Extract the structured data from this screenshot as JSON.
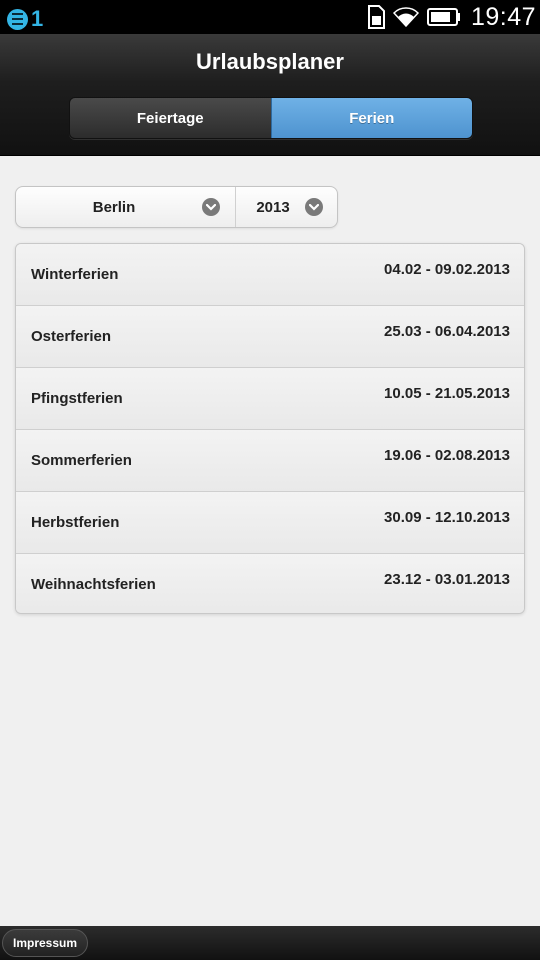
{
  "status_bar": {
    "notification_count": "1",
    "time": "19:47",
    "icons": [
      "notification-icon",
      "sim-icon",
      "wifi-icon",
      "battery-icon"
    ]
  },
  "header": {
    "title": "Urlaubsplaner",
    "tabs": [
      {
        "label": "Feiertage",
        "active": false
      },
      {
        "label": "Ferien",
        "active": true
      }
    ]
  },
  "filters": {
    "state": "Berlin",
    "year": "2013"
  },
  "holidays": [
    {
      "name": "Winterferien",
      "dates": "04.02 - 09.02.2013"
    },
    {
      "name": "Osterferien",
      "dates": "25.03 - 06.04.2013"
    },
    {
      "name": "Pfingstferien",
      "dates": "10.05 - 21.05.2013"
    },
    {
      "name": "Sommerferien",
      "dates": "19.06 - 02.08.2013"
    },
    {
      "name": "Herbstferien",
      "dates": "30.09 - 12.10.2013"
    },
    {
      "name": "Weihnachtsferien",
      "dates": "23.12 - 03.01.2013"
    }
  ],
  "footer": {
    "impressum_label": "Impressum"
  },
  "colors": {
    "accent_blue": "#5a9fd9",
    "status_blue": "#33b5e5"
  }
}
